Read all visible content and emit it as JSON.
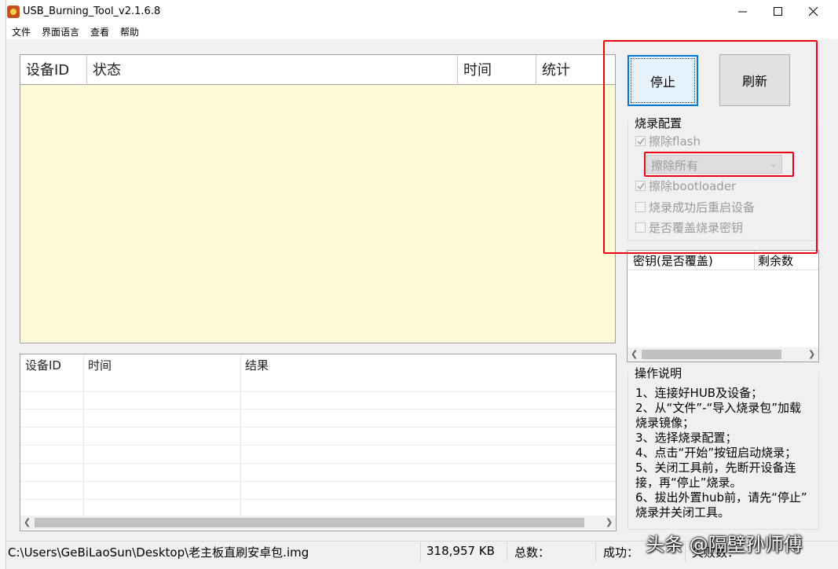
{
  "window": {
    "title": "USB_Burning_Tool_v2.1.6.8",
    "controls": {
      "minimize": "minimize-icon",
      "maximize": "maximize-icon",
      "close": "close-icon"
    }
  },
  "menu": [
    "文件",
    "界面语言",
    "查看",
    "帮助"
  ],
  "device_table": {
    "columns": [
      "设备ID",
      "状态",
      "时间",
      "统计"
    ]
  },
  "result_table": {
    "columns": [
      "设备ID",
      "时间",
      "结果"
    ]
  },
  "buttons": {
    "stop": "停止",
    "refresh": "刷新"
  },
  "config": {
    "title": "烧录配置",
    "erase_flash": {
      "label": "擦除flash",
      "checked": true
    },
    "erase_mode": "擦除所有",
    "erase_bootloader": {
      "label": "擦除bootloader",
      "checked": true
    },
    "reboot_after": {
      "label": "烧录成功后重启设备",
      "checked": false
    },
    "overwrite_key": {
      "label": "是否覆盖烧录密钥",
      "checked": false
    }
  },
  "key_table": {
    "columns": [
      "密钥(是否覆盖)",
      "剩余数"
    ]
  },
  "instructions": {
    "title": "操作说明",
    "lines": [
      "1、连接好HUB及设备；",
      "2、从“文件”-“导入烧录包”加载",
      "烧录镜像；",
      "3、选择烧录配置；",
      "4、点击“开始”按钮启动烧录；",
      "5、关闭工具前，先断开设备连",
      "接，再“停止”烧录。",
      "6、拔出外置hub前，请先“停止”",
      "烧录并关闭工具。"
    ]
  },
  "status": {
    "path": "C:\\Users\\GeBiLaoSun\\Desktop\\老主板直刷安卓包.img",
    "size": "318,957 KB",
    "total_label": "总数：",
    "success_label": "成功：",
    "fail_label": "失败数："
  },
  "watermark": "头条 @隔壁孙师傅",
  "colors": {
    "highlight": "#e60012",
    "table_bg": "#fdfbd6",
    "focus": "#0078d7"
  }
}
